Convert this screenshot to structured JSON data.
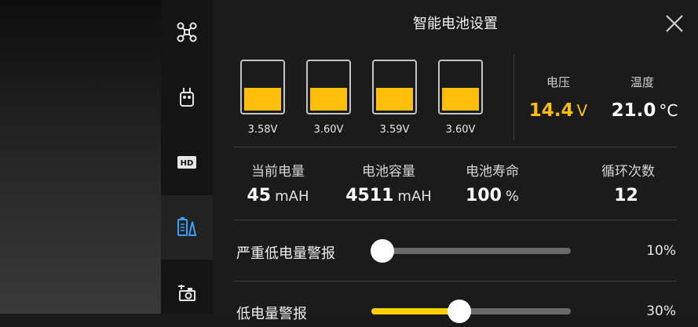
{
  "header": {
    "title": "智能电池设置"
  },
  "cells": [
    {
      "voltage_label": "3.58V",
      "level": 0.45
    },
    {
      "voltage_label": "3.60V",
      "level": 0.45
    },
    {
      "voltage_label": "3.59V",
      "level": 0.45
    },
    {
      "voltage_label": "3.60V",
      "level": 0.45
    }
  ],
  "voltage": {
    "label": "电压",
    "value": "14.4",
    "unit": "V"
  },
  "temperature": {
    "label": "温度",
    "value": "21.0",
    "unit": "°C"
  },
  "stats": [
    {
      "label": "当前电量",
      "value": "45",
      "unit": "mAH"
    },
    {
      "label": "电池容量",
      "value": "4511",
      "unit": "mAH"
    },
    {
      "label": "电池寿命",
      "value": "100",
      "unit": "%"
    },
    {
      "label": "循环次数",
      "value": "12",
      "unit": ""
    }
  ],
  "sliders": [
    {
      "label": "严重低电量警报",
      "value_text": "10%",
      "value": 0.1,
      "fill_color": ""
    },
    {
      "label": "低电量警报",
      "value_text": "30%",
      "value": 0.3,
      "fill_color": "#ffd000"
    }
  ],
  "sidebar": {
    "items": [
      {
        "icon": "drone-icon",
        "active": false
      },
      {
        "icon": "remote-controller-icon",
        "active": false
      },
      {
        "icon": "hd-icon",
        "active": false
      },
      {
        "icon": "battery-settings-icon",
        "active": true
      },
      {
        "icon": "gimbal-camera-icon",
        "active": false
      }
    ]
  },
  "colors": {
    "accent": "#ffbe0a",
    "active_icon": "#3aa0ff",
    "background": "#1b1b1b"
  }
}
